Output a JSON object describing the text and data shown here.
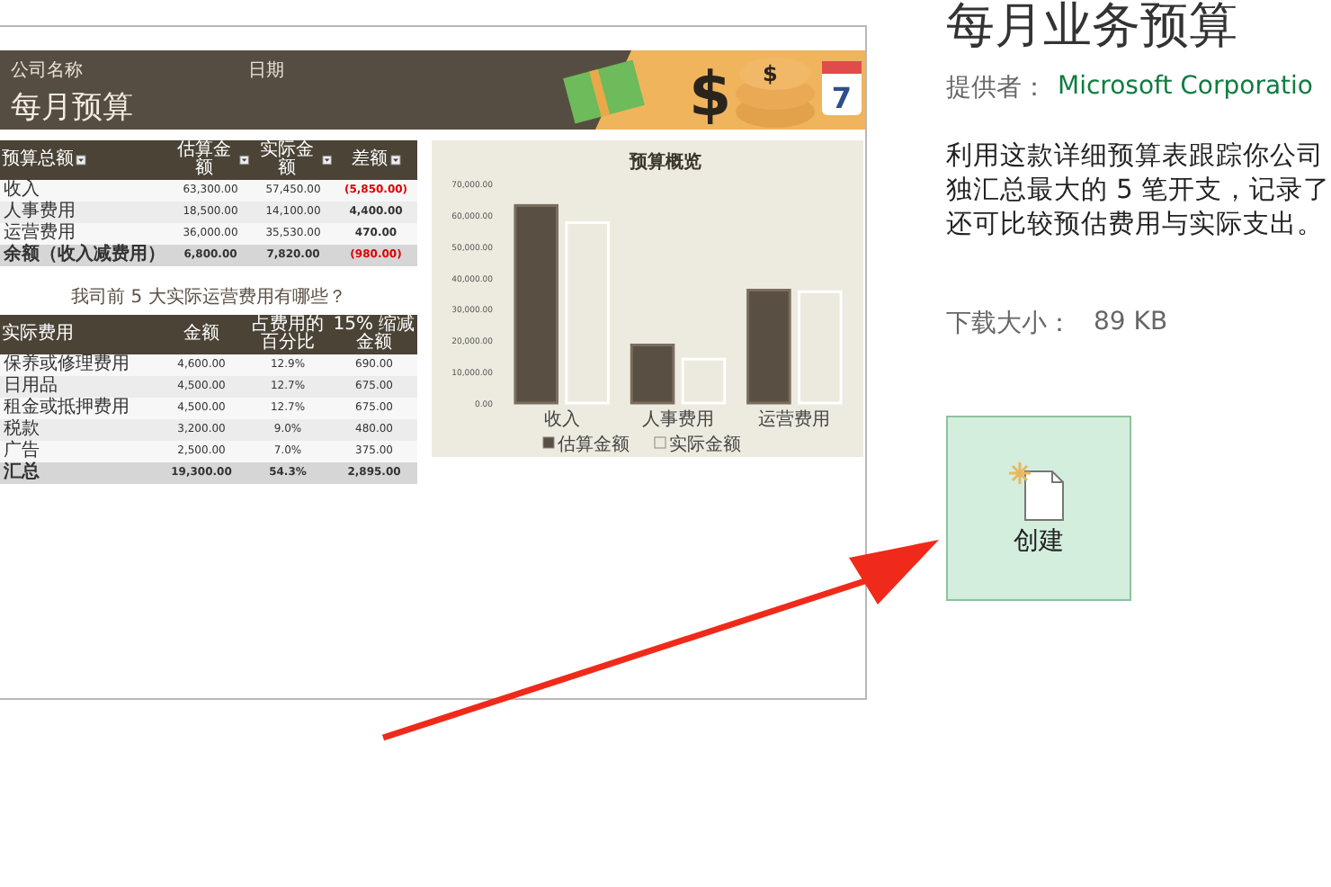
{
  "preview": {
    "header": {
      "company": "公司名称",
      "date_label": "日期",
      "title": "每月预算",
      "currency_symbol": "$",
      "calendar_day": "7"
    },
    "budget_table": {
      "columns": [
        "预算总额",
        "估算金额",
        "实际金额",
        "差额"
      ],
      "rows": [
        {
          "cells": [
            "收入",
            "63,300.00",
            "57,450.00",
            "(5,850.00)"
          ],
          "negative": true,
          "total": false
        },
        {
          "cells": [
            "人事费用",
            "18,500.00",
            "14,100.00",
            "4,400.00"
          ],
          "negative": false,
          "total": false
        },
        {
          "cells": [
            "运营费用",
            "36,000.00",
            "35,530.00",
            "470.00"
          ],
          "negative": false,
          "total": false
        },
        {
          "cells": [
            "余额（收入减费用）",
            "6,800.00",
            "7,820.00",
            "(980.00)"
          ],
          "negative": true,
          "total": true
        }
      ]
    },
    "expense_table": {
      "title": "我司前 5 大实际运营费用有哪些？",
      "columns": [
        "实际费用",
        "金额",
        "占费用的百分比",
        "15% 缩减金额"
      ],
      "rows": [
        {
          "cells": [
            "保养或修理费用",
            "4,600.00",
            "12.9%",
            "690.00"
          ],
          "total": false
        },
        {
          "cells": [
            "日用品",
            "4,500.00",
            "12.7%",
            "675.00"
          ],
          "total": false
        },
        {
          "cells": [
            "租金或抵押费用",
            "4,500.00",
            "12.7%",
            "675.00"
          ],
          "total": false
        },
        {
          "cells": [
            "税款",
            "3,200.00",
            "9.0%",
            "480.00"
          ],
          "total": false
        },
        {
          "cells": [
            "广告",
            "2,500.00",
            "7.0%",
            "375.00"
          ],
          "total": false
        },
        {
          "cells": [
            "汇总",
            "19,300.00",
            "54.3%",
            "2,895.00"
          ],
          "total": true
        }
      ]
    },
    "chart": {
      "chart_data": {
        "type": "bar",
        "title": "预算概览",
        "categories": [
          "收入",
          "人事费用",
          "运营费用"
        ],
        "series": [
          {
            "name": "估算金额",
            "color": "#5a4f43",
            "values": [
              63000,
              18500,
              36000
            ]
          },
          {
            "name": "实际金额",
            "color": "#ece9df",
            "values": [
              57500,
              14000,
              35500
            ]
          }
        ],
        "ylim": [
          0,
          70000
        ],
        "yticks": [
          {
            "value": 0,
            "label": "0.00"
          },
          {
            "value": 10000,
            "label": "10,000.00"
          },
          {
            "value": 20000,
            "label": "20,000.00"
          },
          {
            "value": 30000,
            "label": "30,000.00"
          },
          {
            "value": 40000,
            "label": "40,000.00"
          },
          {
            "value": 50000,
            "label": "50,000.00"
          },
          {
            "value": 60000,
            "label": "60,000.00"
          },
          {
            "value": 70000,
            "label": "70,000.00"
          }
        ]
      }
    }
  },
  "details": {
    "title": "每月业务预算",
    "provider_label": "提供者：",
    "provider": "Microsoft Corporatio",
    "description": [
      "利用这款详细预算表跟踪你公司",
      "独汇总最大的 5 笔开支，记录了",
      "还可比较预估费用与实际支出。"
    ],
    "size_label": "下载大小：",
    "size": "89 KB",
    "create_button": "创建"
  }
}
